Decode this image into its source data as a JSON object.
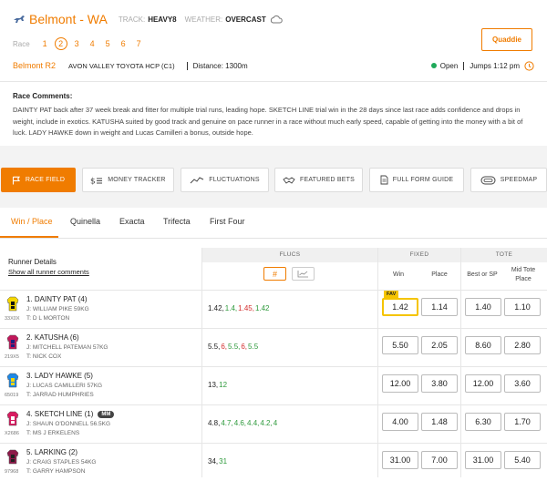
{
  "header": {
    "venue": "Belmont - WA",
    "track_label": "TRACK:",
    "track_value": "HEAVY8",
    "weather_label": "WEATHER:",
    "weather_value": "OVERCAST",
    "race_label": "Race",
    "races": [
      "1",
      "2",
      "3",
      "4",
      "5",
      "6",
      "7"
    ],
    "active_race": "2",
    "quaddie_label": "Quaddie",
    "race_code": "Belmont R2",
    "race_name": "AVON VALLEY TOYOTA HCP (C1)",
    "distance": "Distance: 1300m",
    "status": "Open",
    "jumps": "Jumps 1:12 pm",
    "accent": "#f07c00"
  },
  "comments": {
    "title": "Race Comments:",
    "text": "DAINTY PAT back after 37 week break and fitter for multiple trial runs, leading hope. SKETCH LINE trial win in the 28 days since last race adds confidence and drops in weight, include in exotics. KATUSHA suited by good track and genuine on pace runner in a race without much early speed, capable of getting into the money with a bit of luck. LADY HAWKE down in weight and Lucas Camilleri a bonus, outside hope."
  },
  "tools": [
    {
      "label": "RACE FIELD",
      "icon": "flag-icon"
    },
    {
      "label": "MONEY TRACKER",
      "icon": "dollar-bars-icon"
    },
    {
      "label": "FLUCTUATIONS",
      "icon": "line-chart-icon"
    },
    {
      "label": "FEATURED BETS",
      "icon": "handshake-icon"
    },
    {
      "label": "FULL FORM GUIDE",
      "icon": "document-icon"
    },
    {
      "label": "SPEEDMAP",
      "icon": "speedmap-icon"
    }
  ],
  "tabs": [
    "Win / Place",
    "Quinella",
    "Exacta",
    "Trifecta",
    "First Four"
  ],
  "table": {
    "runner_details": "Runner Details",
    "show_comments": "Show all runner comments",
    "flucs": "FLUCS",
    "fixed": "FIXED",
    "tote": "TOTE",
    "flucs_hash": "#",
    "win": "Win",
    "place": "Place",
    "best_or_sp": "Best or SP",
    "mid_tote_place": "Mid Tote Place",
    "fav_label": "FAV"
  },
  "runners": [
    {
      "name": "1. DAINTY PAT (4)",
      "form": "33X0X",
      "jockey": "J: WILLIAM PIKE 59KG",
      "trainer": "T: D L MORTON",
      "flucs": [
        {
          "v": "1.42,",
          "c": "n"
        },
        {
          "v": "1.4,",
          "c": "down"
        },
        {
          "v": "1.45,",
          "c": "up"
        },
        {
          "v": "1.42",
          "c": "down"
        }
      ],
      "win": "1.42",
      "place": "1.14",
      "tote_win": "1.40",
      "tote_place": "1.10",
      "fav": true,
      "silk": {
        "body": "#f5d600",
        "pattern": "#111111"
      }
    },
    {
      "name": "2. KATUSHA (6)",
      "form": "219X5",
      "jockey": "J: MITCHELL PATEMAN 57KG",
      "trainer": "T: NICK COX",
      "flucs": [
        {
          "v": "5.5,",
          "c": "n"
        },
        {
          "v": "6,",
          "c": "up"
        },
        {
          "v": "5.5,",
          "c": "down"
        },
        {
          "v": "6,",
          "c": "up"
        },
        {
          "v": "5.5",
          "c": "down"
        }
      ],
      "win": "5.50",
      "place": "2.05",
      "tote_win": "8.60",
      "tote_place": "2.80",
      "fav": false,
      "silk": {
        "body": "#c2185b",
        "pattern": "#1a237e"
      }
    },
    {
      "name": "3. LADY HAWKE (5)",
      "form": "65019",
      "jockey": "J: LUCAS CAMILLERI 57KG",
      "trainer": "T: JARRAD HUMPHRIES",
      "flucs": [
        {
          "v": "13,",
          "c": "n"
        },
        {
          "v": "12",
          "c": "down"
        }
      ],
      "win": "12.00",
      "place": "3.80",
      "tote_win": "12.00",
      "tote_place": "3.60",
      "fav": false,
      "silk": {
        "body": "#1e88e5",
        "pattern": "#f5d600"
      }
    },
    {
      "name": "4. SKETCH LINE (1)",
      "badge": "MM",
      "form": "X2686",
      "jockey": "J: SHAUN O'DONNELL 56.5KG",
      "trainer": "T: MS J ERKELENS",
      "flucs": [
        {
          "v": "4.8,",
          "c": "n"
        },
        {
          "v": "4.7,",
          "c": "down"
        },
        {
          "v": "4.6,",
          "c": "down"
        },
        {
          "v": "4.4,",
          "c": "down"
        },
        {
          "v": "4.2,",
          "c": "down"
        },
        {
          "v": "4",
          "c": "down"
        }
      ],
      "win": "4.00",
      "place": "1.48",
      "tote_win": "6.30",
      "tote_place": "1.70",
      "fav": false,
      "silk": {
        "body": "#d81b60",
        "pattern": "#ffffff"
      }
    },
    {
      "name": "5. LARKING (2)",
      "form": "97968",
      "jockey": "J: CRAIG STAPLES 54KG",
      "trainer": "T: GARRY HAMPSON",
      "flucs": [
        {
          "v": "34,",
          "c": "n"
        },
        {
          "v": "31",
          "c": "down"
        }
      ],
      "win": "31.00",
      "place": "7.00",
      "tote_win": "31.00",
      "tote_place": "5.40",
      "fav": false,
      "silk": {
        "body": "#8e1a4a",
        "pattern": "#222222"
      }
    }
  ]
}
